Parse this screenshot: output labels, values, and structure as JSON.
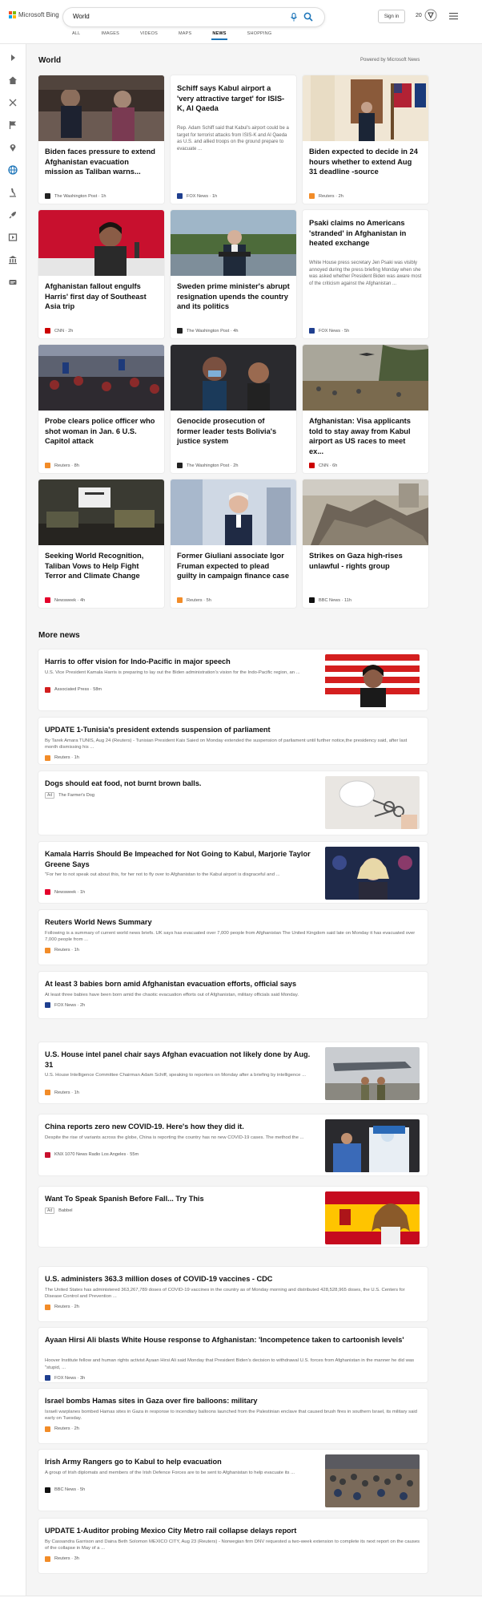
{
  "header": {
    "logo_text": "Microsoft Bing",
    "search_value": "World",
    "sign_in": "Sign in",
    "rewards_count": "20",
    "tabs": [
      "ALL",
      "IMAGES",
      "VIDEOS",
      "MAPS",
      "NEWS",
      "SHOPPING"
    ],
    "active_tab": "NEWS"
  },
  "colors": {
    "accent": "#1a73b8",
    "logo_red": "#f25022",
    "logo_green": "#7fba00",
    "logo_blue": "#00a4ef",
    "logo_yellow": "#ffb900"
  },
  "sidebar_icons": [
    "expand-icon",
    "home-icon",
    "crosshair-icon",
    "flag-icon",
    "location-pin-icon",
    "globe-icon",
    "microscope-icon",
    "rocket-icon",
    "film-icon",
    "bank-icon",
    "scroll-icon"
  ],
  "world": {
    "title": "World",
    "powered_by": "Powered by Microsoft News",
    "cards": [
      {
        "title": "Biden faces pressure to extend Afghanistan evacuation mission as Taliban warns...",
        "excerpt": "",
        "source": "The Washington Post",
        "time": "1h",
        "has_image": true
      },
      {
        "title": "Schiff says Kabul airport a 'very attractive target' for ISIS-K, Al Qaeda",
        "excerpt": "Rep. Adam Schiff said that Kabul's airport could be a target for terrorist attacks from ISIS-K and Al Qaeda as U.S. and allied troops on the ground prepare to evacuate ...",
        "source": "FOX News",
        "time": "1h",
        "has_image": false
      },
      {
        "title": "Biden expected to decide in 24 hours whether to extend Aug 31 deadline -source",
        "excerpt": "",
        "source": "Reuters",
        "time": "2h",
        "has_image": true
      },
      {
        "title": "Afghanistan fallout engulfs Harris' first day of Southeast Asia trip",
        "excerpt": "",
        "source": "CNN",
        "time": "2h",
        "has_image": true
      },
      {
        "title": "Sweden prime minister's abrupt resignation upends the country and its politics",
        "excerpt": "",
        "source": "The Washington Post",
        "time": "4h",
        "has_image": true
      },
      {
        "title": "Psaki claims no Americans 'stranded' in Afghanistan in heated exchange",
        "excerpt": "White House press secretary Jen Psaki was visibly annoyed during the press briefing Monday when she was asked whether President Biden was aware most of the criticism against the Afghanistan ...",
        "source": "FOX News",
        "time": "5h",
        "has_image": false
      },
      {
        "title": "Probe clears police officer who shot woman in Jan. 6 U.S. Capitol attack",
        "excerpt": "",
        "source": "Reuters",
        "time": "8h",
        "has_image": true
      },
      {
        "title": "Genocide prosecution of former leader tests Bolivia's justice system",
        "excerpt": "",
        "source": "The Washington Post",
        "time": "2h",
        "has_image": true
      },
      {
        "title": "Afghanistan: Visa applicants told to stay away from Kabul airport as US races to meet ex...",
        "excerpt": "",
        "source": "CNN",
        "time": "6h",
        "has_image": true
      },
      {
        "title": "Seeking World Recognition, Taliban Vows to Help Fight Terror and Climate Change",
        "excerpt": "",
        "source": "Newsweek",
        "time": "4h",
        "has_image": true
      },
      {
        "title": "Former Giuliani associate Igor Fruman expected to plead guilty in campaign finance case",
        "excerpt": "",
        "source": "Reuters",
        "time": "5h",
        "has_image": true
      },
      {
        "title": "Strikes on Gaza high-rises unlawful - rights group",
        "excerpt": "",
        "source": "BBC News",
        "time": "11h",
        "has_image": true
      }
    ]
  },
  "more_news": {
    "title": "More news",
    "items": [
      {
        "title": "Harris to offer vision for Indo-Pacific in major speech",
        "excerpt": "U.S. Vice President Kamala Harris is preparing to lay out the Biden administration's vision for the Indo-Pacific region, an ...",
        "source": "Associated Press",
        "time": "58m",
        "ad": false,
        "has_image": true
      },
      {
        "title": "UPDATE 1-Tunisia's president extends suspension of parliament",
        "excerpt": "By Tarek Amara TUNIS, Aug 24 (Reuters) - Tunisian President Kais Saied on Monday extended the suspension of parliament until further notice,the presidency said, after last month dismissing his ...",
        "source": "Reuters",
        "time": "1h",
        "ad": false,
        "has_image": false
      },
      {
        "title": "Dogs should eat food, not burnt brown balls.",
        "excerpt": "",
        "source": "The Farmer's Dog",
        "time": "",
        "ad": true,
        "ad_label": "Ad",
        "has_image": true
      },
      {
        "title": "Kamala Harris Should Be Impeached for Not Going to Kabul, Marjorie Taylor Greene Says",
        "excerpt": "\"For her to not speak out about this, for her not to fly over to Afghanistan to the Kabul airport is disgraceful and ...",
        "source": "Newsweek",
        "time": "1h",
        "ad": false,
        "has_image": true
      },
      {
        "title": "Reuters World News Summary",
        "excerpt": "Following is a summary of current world news briefs. UK says has evacuated over 7,000 people from Afghanistan The United Kingdom said late on Monday it has evacuated over 7,000 people from ...",
        "source": "Reuters",
        "time": "1h",
        "ad": false,
        "has_image": false
      },
      {
        "title": "At least 3 babies born amid Afghanistan evacuation efforts, official says",
        "excerpt": "At least three babies have been born amid the chaotic evacuation efforts out of Afghanistan, military officials said Monday.",
        "source": "FOX News",
        "time": "2h",
        "ad": false,
        "has_image": false
      },
      {
        "title": "U.S. House intel panel chair says Afghan evacuation not likely done by Aug. 31",
        "excerpt": "U.S. House Intelligence Committee Chairman Adam Schiff, speaking to reporters on Monday after a briefing by intelligence ...",
        "source": "Reuters",
        "time": "1h",
        "ad": false,
        "has_image": true
      },
      {
        "title": "China reports zero new COVID-19. Here's how they did it.",
        "excerpt": "Despite the rise of variants across the globe, China is reporting the country has no new COVID-19 cases. The method the ...",
        "source": "KNX 1070 News Radio Los Angeles",
        "time": "55m",
        "ad": false,
        "has_image": true
      },
      {
        "title": "Want To Speak Spanish Before Fall... Try This",
        "excerpt": "",
        "source": "Babbel",
        "time": "",
        "ad": true,
        "ad_label": "Ad",
        "has_image": true
      },
      {
        "title": "U.S. administers 363.3 million doses of COVID-19 vaccines - CDC",
        "excerpt": "The United States has administered 363,267,789 doses of COVID-19 vaccines in the country as of Monday morning and distributed 428,528,965 doses, the U.S. Centers for Disease Control and Prevention ...",
        "source": "Reuters",
        "time": "2h",
        "ad": false,
        "has_image": false
      },
      {
        "title": "Ayaan Hirsi Ali blasts White House response to Afghanistan: 'Incompetence taken to cartoonish levels'",
        "excerpt": "Hoover Institute fellow and human rights activist Ayaan Hirsi Ali said Monday that President Biden's decision to withdrawal U.S. forces from Afghanistan in the manner he did was \"stupid, ...",
        "source": "FOX News",
        "time": "3h",
        "ad": false,
        "has_image": false
      },
      {
        "title": "Israel bombs Hamas sites in Gaza over fire balloons: military",
        "excerpt": "Israeli warplanes bombed Hamas sites in Gaza in response to incendiary balloons launched from the Palestinian enclave that caused brush fires in southern Israel, its military said early on Tuesday.",
        "source": "Reuters",
        "time": "2h",
        "ad": false,
        "has_image": false
      },
      {
        "title": "Irish Army Rangers go to Kabul to help evacuation",
        "excerpt": "A group of Irish diplomats and members of the Irish Defence Forces are to be sent to Afghanistan to help evacuate its ...",
        "source": "BBC News",
        "time": "5h",
        "ad": false,
        "has_image": true
      },
      {
        "title": "UPDATE 1-Auditor probing Mexico City Metro rail collapse delays report",
        "excerpt": "By Cassandra Garrison and Daina Beth Solomon MEXICO CITY, Aug 23 (Reuters) - Norwegian firm DNV requested a two-week extension to complete its next report on the causes of the collapse in May of a ...",
        "source": "Reuters",
        "time": "3h",
        "ad": false,
        "has_image": false
      }
    ]
  }
}
